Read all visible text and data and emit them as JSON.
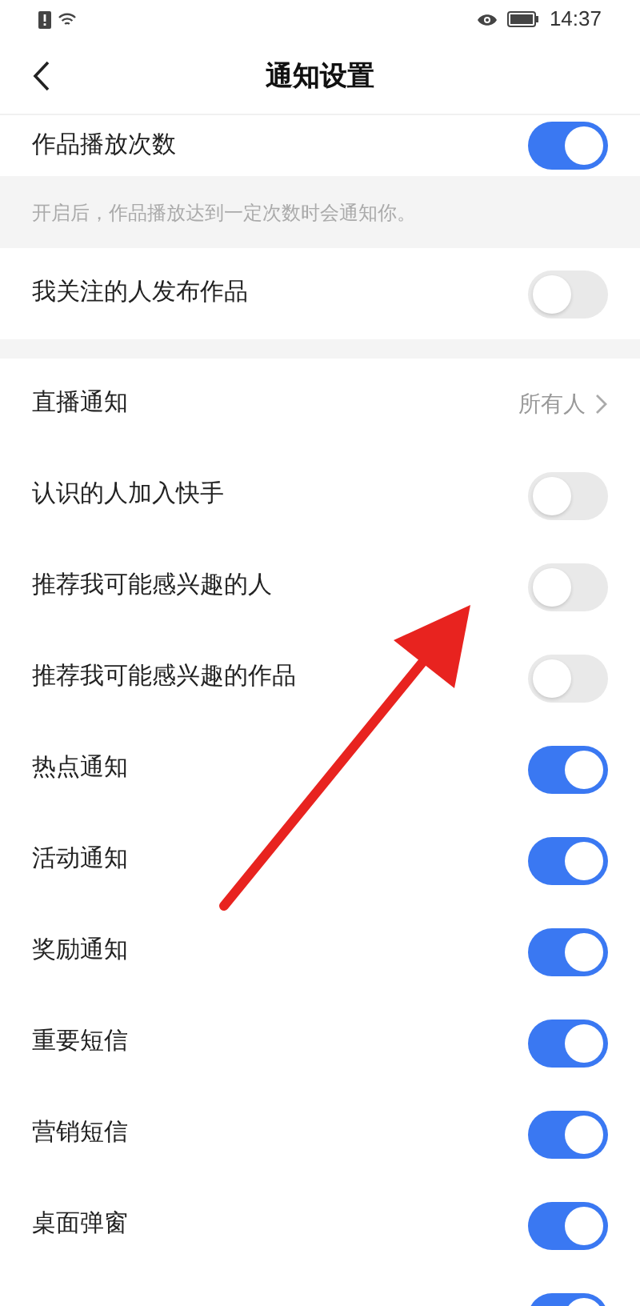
{
  "status_bar": {
    "time": "14:37"
  },
  "header": {
    "title": "通知设置"
  },
  "top_row": {
    "label": "作品播放次数",
    "on": true
  },
  "hint": "开启后，作品播放达到一定次数时会通知你。",
  "follow_row": {
    "label": "我关注的人发布作品",
    "on": false
  },
  "rows": [
    {
      "kind": "link",
      "label": "直播通知",
      "value": "所有人"
    },
    {
      "kind": "switch",
      "label": "认识的人加入快手",
      "on": false
    },
    {
      "kind": "switch",
      "label": "推荐我可能感兴趣的人",
      "on": false
    },
    {
      "kind": "switch",
      "label": "推荐我可能感兴趣的作品",
      "on": false
    },
    {
      "kind": "switch",
      "label": "热点通知",
      "on": true
    },
    {
      "kind": "switch",
      "label": "活动通知",
      "on": true
    },
    {
      "kind": "switch",
      "label": "奖励通知",
      "on": true
    },
    {
      "kind": "switch",
      "label": "重要短信",
      "on": true
    },
    {
      "kind": "switch",
      "label": "营销短信",
      "on": true
    },
    {
      "kind": "switch",
      "label": "桌面弹窗",
      "on": true
    },
    {
      "kind": "switch",
      "on": true
    }
  ]
}
